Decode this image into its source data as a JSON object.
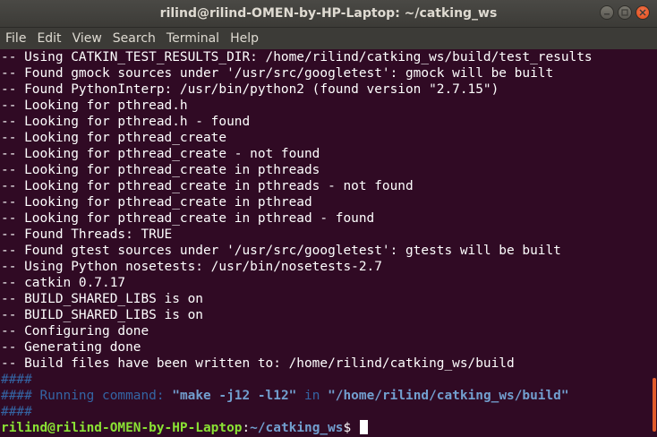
{
  "window": {
    "title": "rilind@rilind-OMEN-by-HP-Laptop: ~/catking_ws"
  },
  "menubar": {
    "items": [
      "File",
      "Edit",
      "View",
      "Search",
      "Terminal",
      "Help"
    ]
  },
  "terminal": {
    "output_lines": [
      "-- Using CATKIN_TEST_RESULTS_DIR: /home/rilind/catking_ws/build/test_results",
      "-- Found gmock sources under '/usr/src/googletest': gmock will be built",
      "-- Found PythonInterp: /usr/bin/python2 (found version \"2.7.15\")",
      "-- Looking for pthread.h",
      "-- Looking for pthread.h - found",
      "-- Looking for pthread_create",
      "-- Looking for pthread_create - not found",
      "-- Looking for pthread_create in pthreads",
      "-- Looking for pthread_create in pthreads - not found",
      "-- Looking for pthread_create in pthread",
      "-- Looking for pthread_create in pthread - found",
      "-- Found Threads: TRUE",
      "-- Found gtest sources under '/usr/src/googletest': gtests will be built",
      "-- Using Python nosetests: /usr/bin/nosetests-2.7",
      "-- catkin 0.7.17",
      "-- BUILD_SHARED_LIBS is on",
      "-- BUILD_SHARED_LIBS is on",
      "-- Configuring done",
      "-- Generating done",
      "-- Build files have been written to: /home/rilind/catking_ws/build"
    ],
    "hash_line_1": "####",
    "running": {
      "prefix": "#### ",
      "label": "Running command: ",
      "command": "\"make -j12 -l12\"",
      "in_word": " in ",
      "dir": "\"/home/rilind/catking_ws/build\""
    },
    "hash_line_2": "####",
    "prompt": {
      "user_host": "rilind@rilind-OMEN-by-HP-Laptop",
      "colon": ":",
      "path": "~/catking_ws",
      "symbol": "$ "
    }
  },
  "colors": {
    "background": "#300a24",
    "titlebar": "#3c3b37",
    "prompt_user": "#8ae234",
    "prompt_path": "#729fcf",
    "hash_blue": "#3465a4",
    "scroll_thumb": "#e05a2b"
  },
  "icons": {
    "minimize": "minimize-icon",
    "maximize": "maximize-icon",
    "close": "close-icon"
  }
}
